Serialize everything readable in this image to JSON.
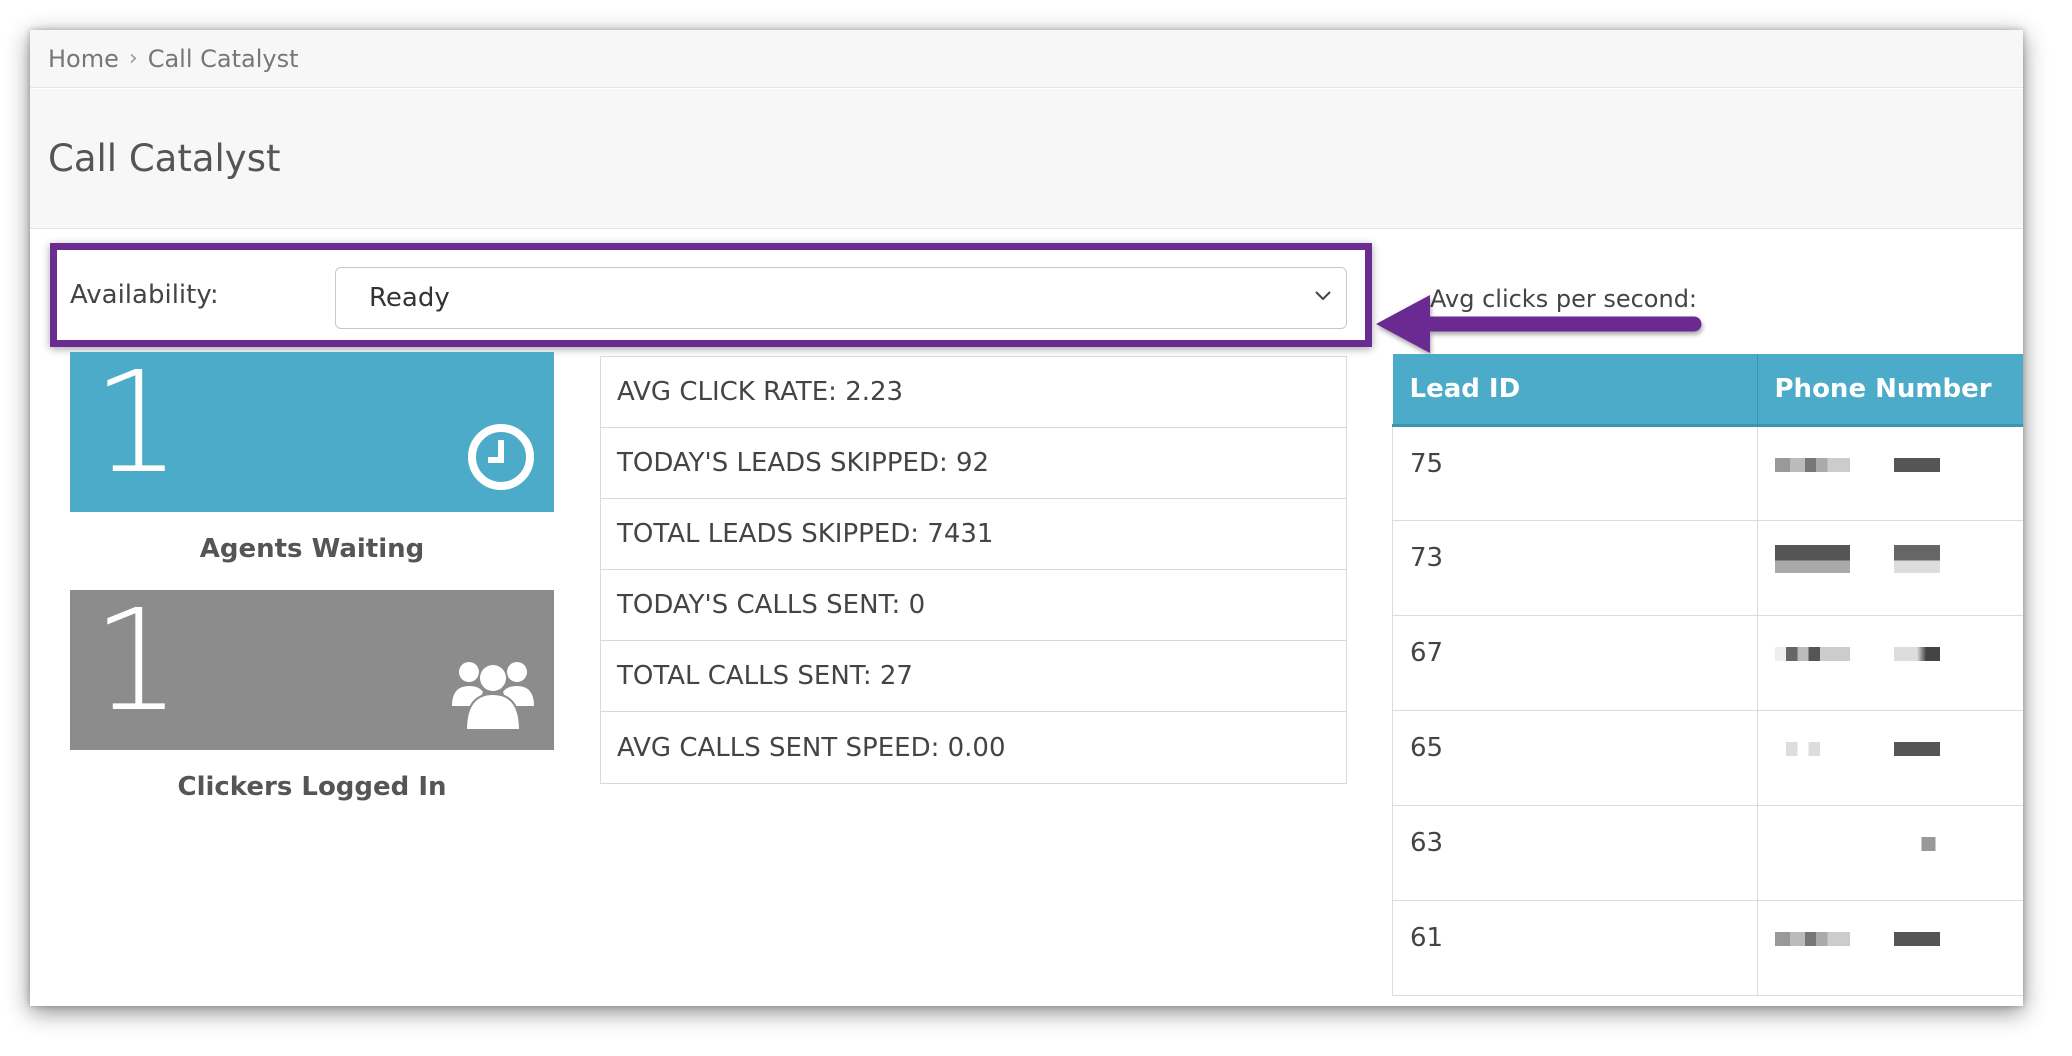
{
  "breadcrumb": {
    "home": "Home",
    "separator": "›",
    "current": "Call Catalyst"
  },
  "page": {
    "title": "Call Catalyst"
  },
  "availability": {
    "label": "Availability:",
    "selected": "Ready",
    "highlight_color": "#6a2c91"
  },
  "rate_text": "Avg clicks per second:",
  "tiles": [
    {
      "value": "1",
      "caption": "Agents Waiting",
      "icon": "clock-icon",
      "color": "#4cabc8"
    },
    {
      "value": "1",
      "caption": "Clickers Logged In",
      "icon": "users-icon",
      "color": "#8c8c8c"
    }
  ],
  "stats": [
    "AVG CLICK RATE: 2.23",
    "TODAY'S LEADS SKIPPED: 92",
    "TOTAL LEADS SKIPPED: 7431",
    "TODAY'S CALLS SENT: 0",
    "TOTAL CALLS SENT: 27",
    "AVG CALLS SENT SPEED: 0.00"
  ],
  "leads_table": {
    "headers": [
      "Lead ID",
      "Phone Number"
    ],
    "rows": [
      {
        "lead_id": "75",
        "phone": "(redacted)"
      },
      {
        "lead_id": "73",
        "phone": "(redacted)"
      },
      {
        "lead_id": "67",
        "phone": "(redacted)"
      },
      {
        "lead_id": "65",
        "phone": "(redacted)"
      },
      {
        "lead_id": "63",
        "phone": "(redacted)"
      },
      {
        "lead_id": "61",
        "phone": "(redacted)"
      }
    ]
  }
}
